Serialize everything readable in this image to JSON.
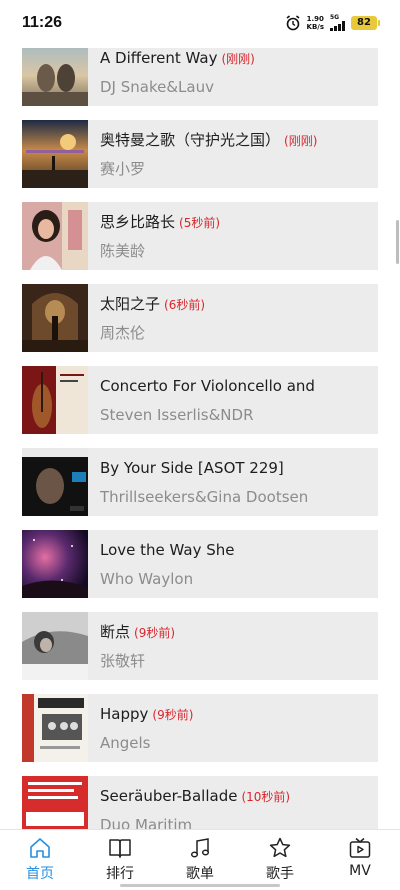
{
  "status": {
    "time": "11:26",
    "net_speed_value": "1.90",
    "net_speed_unit": "KB/s",
    "network_type": "5G",
    "battery": "82",
    "alarm_icon": "alarm-clock-icon"
  },
  "songs": [
    {
      "title": "A Different Way",
      "time": "(刚刚)",
      "artist": "DJ Snake&Lauv"
    },
    {
      "title": "奥特曼之歌（守护光之国）",
      "time": "(刚刚)",
      "artist": "赛小罗"
    },
    {
      "title": "思乡比路长",
      "time": "(5秒前)",
      "artist": "陈美龄"
    },
    {
      "title": "太阳之子",
      "time": "(6秒前)",
      "artist": "周杰伦"
    },
    {
      "title": "Concerto For Violoncello and",
      "time": "",
      "artist": "Steven Isserlis&NDR"
    },
    {
      "title": "By Your Side [ASOT 229]",
      "time": "",
      "artist": "Thrillseekers&Gina Dootsen"
    },
    {
      "title": "Love the Way She",
      "time": "",
      "artist": "Who Waylon"
    },
    {
      "title": "断点",
      "time": "(9秒前)",
      "artist": "张敬轩"
    },
    {
      "title": "Happy",
      "time": "(9秒前)",
      "artist": "Angels"
    },
    {
      "title": "Seeräuber-Ballade",
      "time": "(10秒前)",
      "artist": "Duo Maritim"
    }
  ],
  "tabs": [
    {
      "label": "首页",
      "icon": "home-icon",
      "active": true
    },
    {
      "label": "排行",
      "icon": "book-icon",
      "active": false
    },
    {
      "label": "歌单",
      "icon": "music-note-icon",
      "active": false
    },
    {
      "label": "歌手",
      "icon": "star-icon",
      "active": false
    },
    {
      "label": "MV",
      "icon": "tv-icon",
      "active": false
    }
  ],
  "colors": {
    "accent": "#2a8fe0",
    "time_label": "#d8262d",
    "artist_text": "#8c8c8c",
    "card_background": "#ececec"
  }
}
